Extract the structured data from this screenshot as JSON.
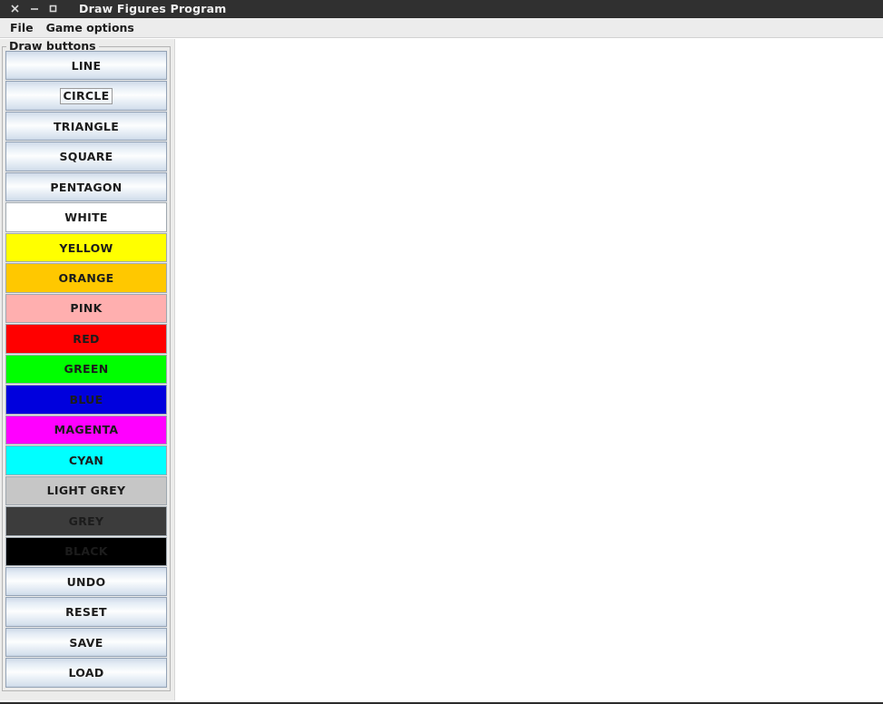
{
  "window": {
    "title": "Draw Figures Program",
    "titlebar_bg": "#303030",
    "controls": [
      {
        "name": "close",
        "glyph": "×"
      },
      {
        "name": "minimize",
        "glyph": "–"
      },
      {
        "name": "maximize",
        "glyph": "□"
      }
    ]
  },
  "menubar": {
    "items": [
      {
        "label": "File"
      },
      {
        "label": "Game options"
      }
    ]
  },
  "panel": {
    "border_title": "Draw buttons",
    "background": "#ececeb"
  },
  "buttons": [
    {
      "label": "LINE",
      "kind": "shape",
      "bg": "gradient",
      "fg": "#1c1c1c",
      "focused": false
    },
    {
      "label": "CIRCLE",
      "kind": "shape",
      "bg": "gradient",
      "fg": "#1c1c1c",
      "focused": true
    },
    {
      "label": "TRIANGLE",
      "kind": "shape",
      "bg": "gradient",
      "fg": "#1c1c1c",
      "focused": false
    },
    {
      "label": "SQUARE",
      "kind": "shape",
      "bg": "gradient",
      "fg": "#1c1c1c",
      "focused": false
    },
    {
      "label": "PENTAGON",
      "kind": "shape",
      "bg": "gradient",
      "fg": "#1c1c1c",
      "focused": false
    },
    {
      "label": "WHITE",
      "kind": "color",
      "bg": "#ffffff",
      "fg": "#1c1c1c",
      "focused": false
    },
    {
      "label": "YELLOW",
      "kind": "color",
      "bg": "#ffff00",
      "fg": "#1c1c1c",
      "focused": false
    },
    {
      "label": "ORANGE",
      "kind": "color",
      "bg": "#ffc800",
      "fg": "#1c1c1c",
      "focused": false
    },
    {
      "label": "PINK",
      "kind": "color",
      "bg": "#ffafaf",
      "fg": "#1c1c1c",
      "focused": false
    },
    {
      "label": "RED",
      "kind": "color",
      "bg": "#ff0000",
      "fg": "#1c1c1c",
      "focused": false
    },
    {
      "label": "GREEN",
      "kind": "color",
      "bg": "#00ff00",
      "fg": "#1c1c1c",
      "focused": false
    },
    {
      "label": "BLUE",
      "kind": "color",
      "bg": "#0000dd",
      "fg": "#1c1c1c",
      "focused": false
    },
    {
      "label": "MAGENTA",
      "kind": "color",
      "bg": "#ff00ff",
      "fg": "#1c1c1c",
      "focused": false
    },
    {
      "label": "CYAN",
      "kind": "color",
      "bg": "#00ffff",
      "fg": "#1c1c1c",
      "focused": false
    },
    {
      "label": "LIGHT GREY",
      "kind": "color",
      "bg": "#c6c6c6",
      "fg": "#1c1c1c",
      "focused": false
    },
    {
      "label": "GREY",
      "kind": "color",
      "bg": "#3c3c3c",
      "fg": "#1c1c1c",
      "focused": false
    },
    {
      "label": "BLACK",
      "kind": "color",
      "bg": "#000000",
      "fg": "#1c1c1c",
      "focused": false
    },
    {
      "label": "UNDO",
      "kind": "action",
      "bg": "gradient",
      "fg": "#1c1c1c",
      "focused": false
    },
    {
      "label": "RESET",
      "kind": "action",
      "bg": "gradient",
      "fg": "#1c1c1c",
      "focused": false
    },
    {
      "label": "SAVE",
      "kind": "action",
      "bg": "gradient",
      "fg": "#1c1c1c",
      "focused": false
    },
    {
      "label": "LOAD",
      "kind": "action",
      "bg": "gradient",
      "fg": "#1c1c1c",
      "focused": false
    }
  ],
  "canvas": {
    "background": "#ffffff",
    "content": ""
  }
}
